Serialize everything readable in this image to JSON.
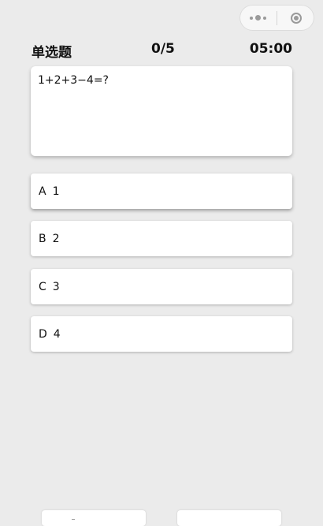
{
  "quiz": {
    "question_type": "单选题",
    "progress": "0/5",
    "timer": "05:00",
    "question": "1+2+3−4=?",
    "options": [
      {
        "letter": "A",
        "text": "1"
      },
      {
        "letter": "B",
        "text": "2"
      },
      {
        "letter": "C",
        "text": "3"
      },
      {
        "letter": "D",
        "text": "4"
      }
    ]
  },
  "capsule": {
    "more_icon": "more-dots-icon",
    "close_icon": "close-miniprogram-icon"
  }
}
